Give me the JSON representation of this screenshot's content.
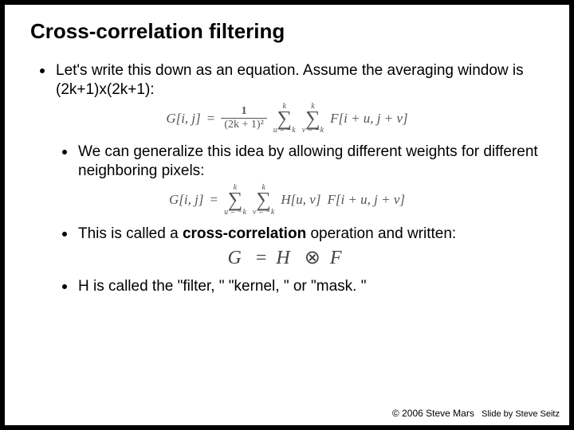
{
  "title": "Cross-correlation filtering",
  "bullets": {
    "b1": "Let's write this down as an equation.  Assume the averaging window is (2k+1)x(2k+1):",
    "b2": "We can generalize this idea by allowing different weights for different neighboring pixels:",
    "b3_pre": "This is called a ",
    "b3_bold": "cross-correlation",
    "b3_post": " operation and written:",
    "b4": "H is called the \"filter, \"  \"kernel, \"  or \"mask. \""
  },
  "eq1": {
    "lhs": "G[i, j]",
    "eq": "=",
    "frac_num": "1",
    "frac_den": "(2k + 1)²",
    "sum_top": "k",
    "sum_bot1": "u = −k",
    "sum_bot2": "v = −k",
    "rhs": "F[i + u, j + v]"
  },
  "eq2": {
    "lhs": "G[i, j]",
    "eq": "=",
    "sum_top": "k",
    "sum_bot1": "u = −k",
    "sum_bot2": "v = −k",
    "mid": "H[u, v]",
    "rhs": "F[i + u, j + v]"
  },
  "eq3": {
    "G": "G",
    "eq": "=",
    "H": "H",
    "op": "⊗",
    "F": "F"
  },
  "footer": {
    "copy": "© 2006 Steve Mars",
    "by": "Slide by Steve Seitz"
  }
}
